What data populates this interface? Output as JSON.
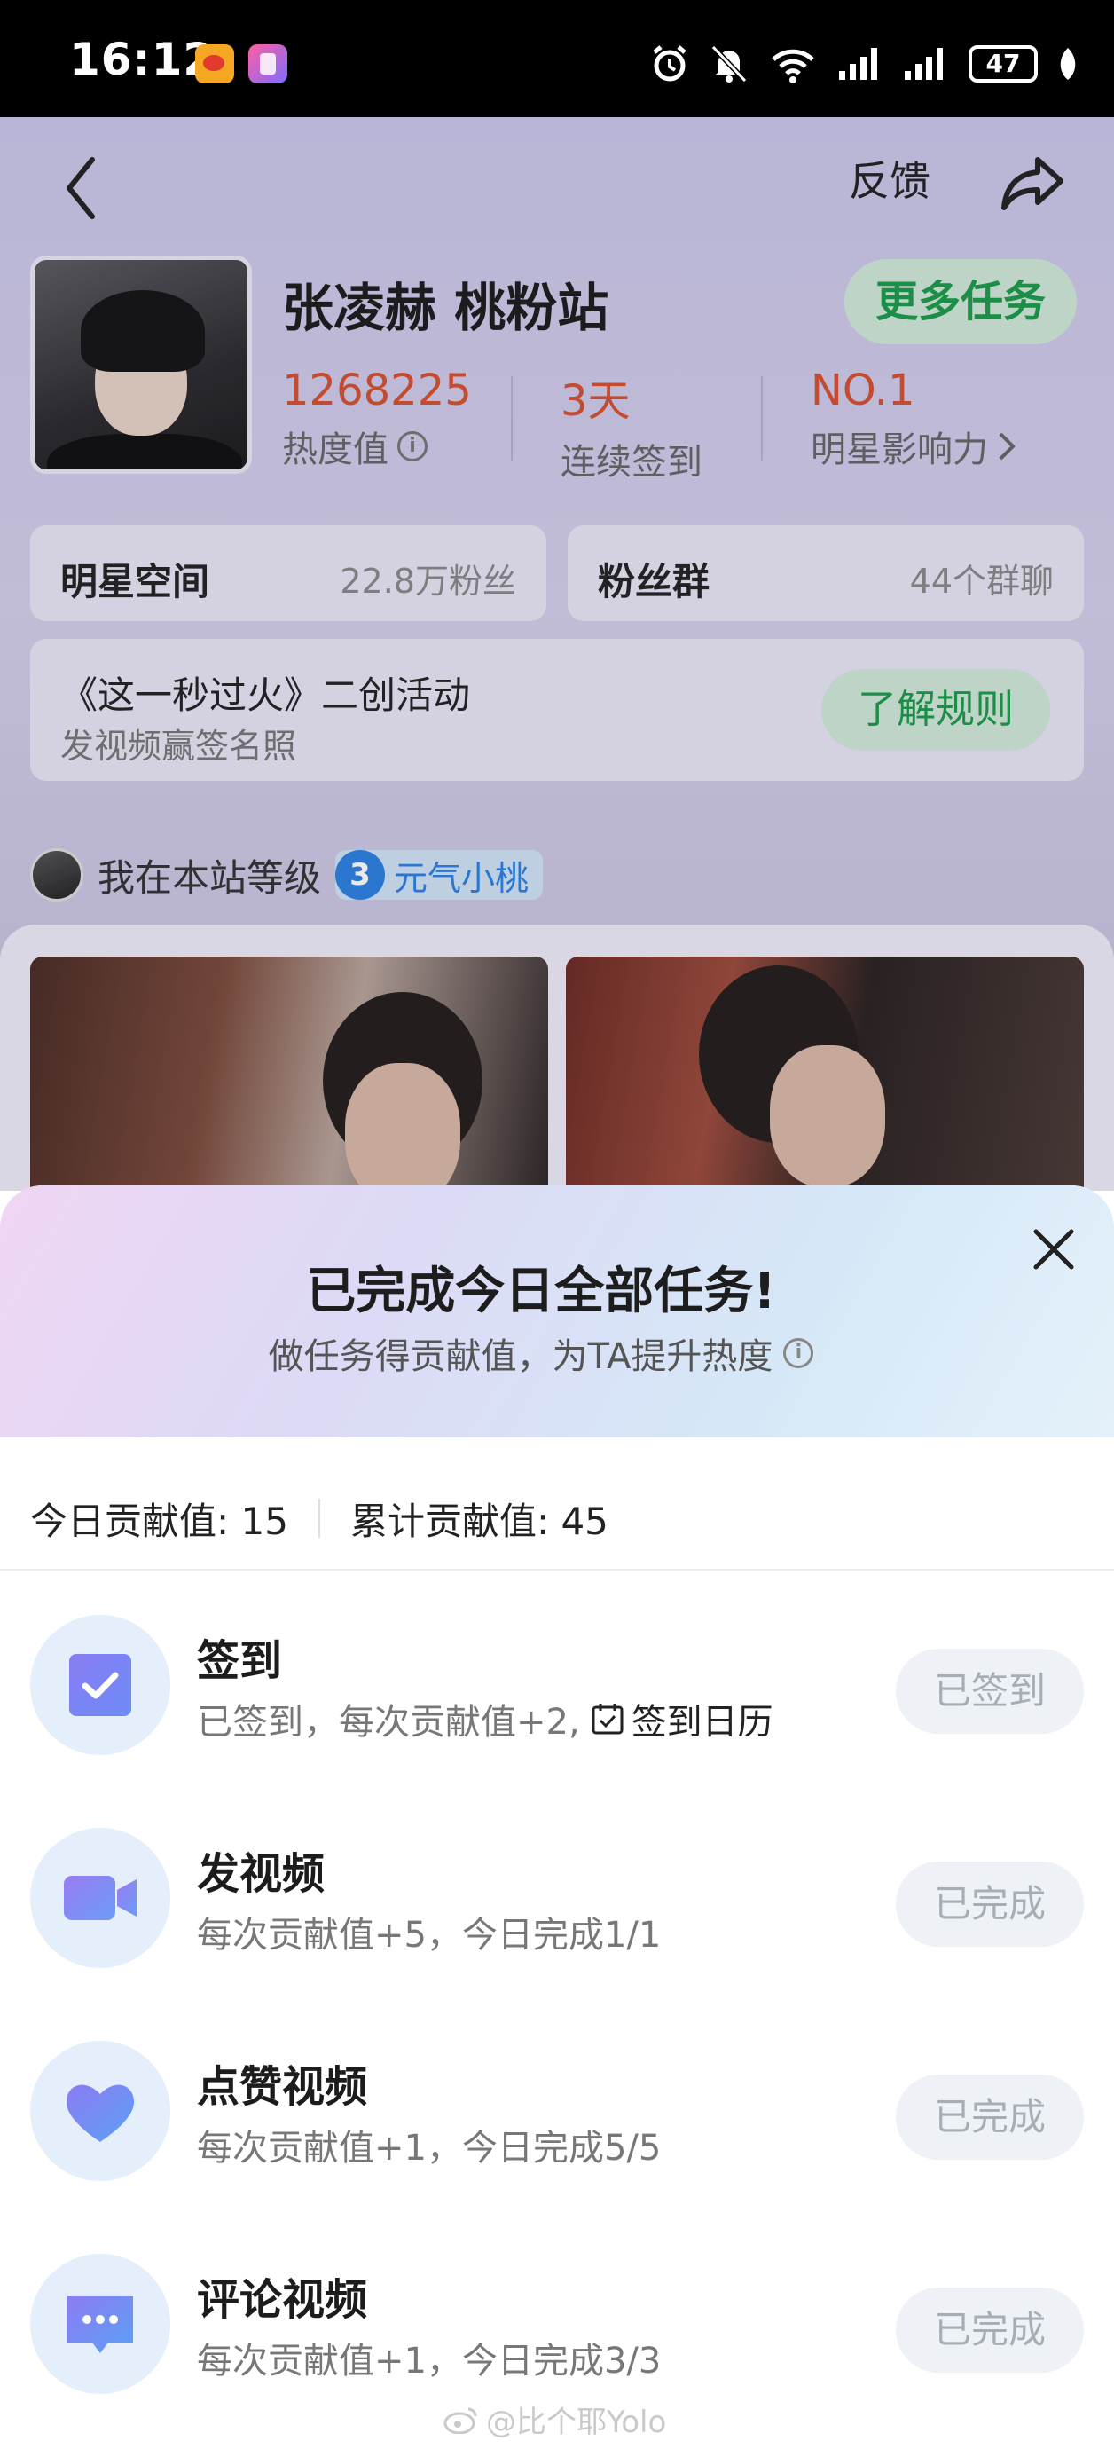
{
  "status_bar": {
    "time": "16:12",
    "battery": "47",
    "icons": [
      "weibo-app-icon",
      "app-icon",
      "alarm-icon",
      "mute-icon",
      "wifi-icon",
      "signal-icon",
      "signal-icon",
      "battery-icon",
      "leaf-icon"
    ]
  },
  "header": {
    "feedback": "反馈"
  },
  "profile": {
    "name": "张凌赫 桃粉站",
    "more_tasks": "更多任务",
    "stats": [
      {
        "value": "1268225",
        "label": "热度值"
      },
      {
        "value": "3天",
        "label": "连续签到"
      },
      {
        "value": "NO.1",
        "label": "明星影响力"
      }
    ],
    "accent_color": "#d5502e"
  },
  "cards": {
    "star_space": {
      "title": "明星空间",
      "sub": "22.8万粉丝"
    },
    "fan_group": {
      "title": "粉丝群",
      "sub": "44个群聊"
    }
  },
  "activity": {
    "title": "《这一秒过火》二创活动",
    "subtitle": "发视频赢签名照",
    "button": "了解规则"
  },
  "level": {
    "label": "我在本站等级",
    "level_num": "3",
    "level_name": "元气小桃"
  },
  "sheet": {
    "title": "已完成今日全部任务!",
    "subtitle": "做任务得贡献值，为TA提升热度",
    "today_contribution": "今日贡献值: 15",
    "total_contribution": "累计贡献值: 45",
    "tasks": [
      {
        "name": "签到",
        "desc": "已签到，每次贡献值+2,",
        "link": "签到日历",
        "status": "已签到",
        "icon": "checkbox-icon"
      },
      {
        "name": "发视频",
        "desc": "每次贡献值+5，今日完成1/1",
        "status": "已完成",
        "icon": "video-camera-icon"
      },
      {
        "name": "点赞视频",
        "desc": "每次贡献值+1，今日完成5/5",
        "status": "已完成",
        "icon": "heart-icon"
      },
      {
        "name": "评论视频",
        "desc": "每次贡献值+1，今日完成3/3",
        "status": "已完成",
        "icon": "comment-icon"
      }
    ]
  },
  "watermark": "@比个耶Yolo"
}
